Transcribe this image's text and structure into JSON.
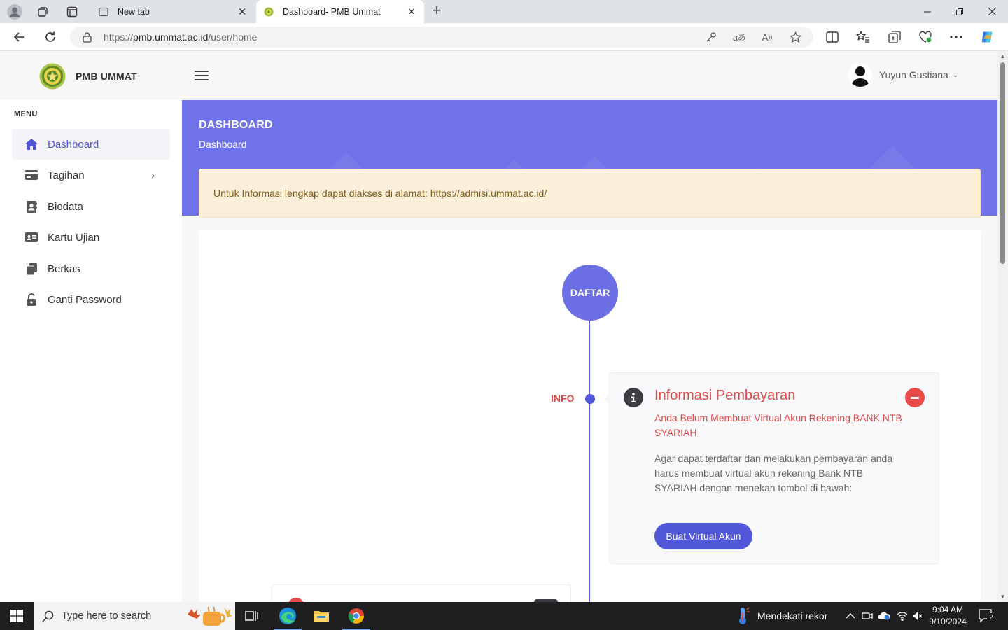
{
  "browser": {
    "tabs": [
      {
        "title": "New tab",
        "active": false
      },
      {
        "title": "Dashboard- PMB Ummat",
        "active": true
      }
    ],
    "url_prefix": "https://",
    "url_host": "pmb.ummat.ac.id",
    "url_path": "/user/home"
  },
  "header": {
    "brand": "PMB UMMAT",
    "user_name": "Yuyun Gustiana"
  },
  "sidebar": {
    "menu_title": "MENU",
    "items": [
      {
        "label": "Dashboard",
        "icon": "home-icon",
        "active": true
      },
      {
        "label": "Tagihan",
        "icon": "credit-card-icon",
        "has_children": true
      },
      {
        "label": "Biodata",
        "icon": "contact-book-icon"
      },
      {
        "label": "Kartu Ujian",
        "icon": "id-card-icon"
      },
      {
        "label": "Berkas",
        "icon": "files-icon"
      },
      {
        "label": "Ganti Password",
        "icon": "unlock-icon"
      }
    ]
  },
  "hero": {
    "title": "DASHBOARD",
    "breadcrumb": "Dashboard"
  },
  "alert": {
    "text": "Untuk Informasi lengkap dapat diakses di alamat: https://admisi.ummat.ac.id/"
  },
  "timeline": {
    "start_label": "DAFTAR",
    "item_label": "INFO",
    "info": {
      "title": "Informasi Pembayaran",
      "subtitle": "Anda Belum Membuat Virtual Akun Rekening BANK NTB SYARIAH",
      "body": "Agar dapat terdaftar dan melakukan pembayaran anda harus membuat virtual akun rekening Bank NTB SYARIAH dengan menekan tombol di bawah:",
      "button_label": "Buat Virtual Akun"
    }
  },
  "taskbar": {
    "search_placeholder": "Type here to search",
    "weather_text": "Mendekati rekor",
    "time": "9:04 AM",
    "date": "9/10/2024",
    "notification_count": "2"
  },
  "colors": {
    "accent": "#5157d9",
    "hero": "#6f72e8",
    "danger": "#e04848",
    "alert_bg": "#fcefd9"
  }
}
